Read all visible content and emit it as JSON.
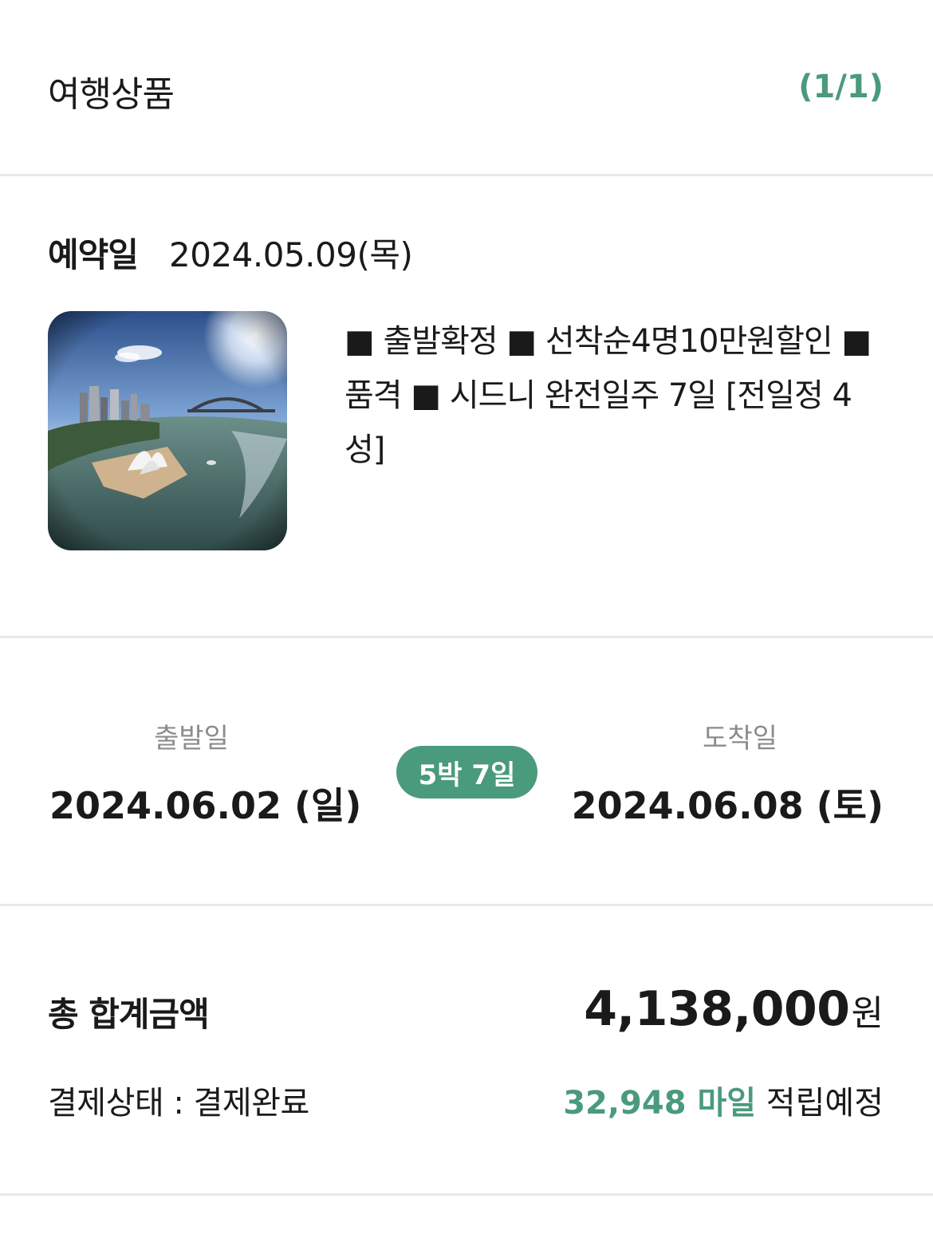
{
  "header": {
    "title": "여행상품",
    "count": "(1/1)"
  },
  "reservation": {
    "label": "예약일",
    "date": "2024.05.09(목)"
  },
  "product": {
    "image_alt": "Sydney harbour aerial photo",
    "name": "■ 출발확정 ■ 선착순4명10만원할인 ■ 품격 ■ 시드니 완전일주 7일 [전일정 4성]"
  },
  "schedule": {
    "departure_label": "출발일",
    "departure_date": "2024.06.02 (일)",
    "duration": "5박 7일",
    "arrival_label": "도착일",
    "arrival_date": "2024.06.08 (토)"
  },
  "payment": {
    "total_label": "총 합계금액",
    "total_value": "4,138,000",
    "total_unit": "원",
    "status": "결제상태 : 결제완료",
    "mileage_value": "32,948 마일",
    "mileage_suffix": " 적립예정"
  },
  "colors": {
    "accent": "#4a9a7c",
    "divider": "#e8e8e8",
    "muted": "#8c8c8c",
    "text": "#1a1a1a"
  }
}
